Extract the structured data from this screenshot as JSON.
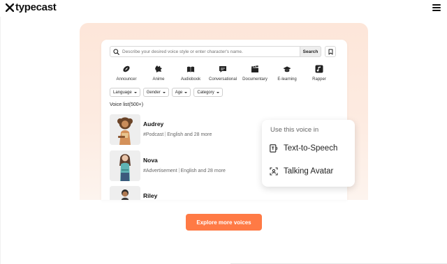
{
  "header": {
    "logo_text": "typecast",
    "menu_icon": "hamburger-menu-icon"
  },
  "search": {
    "placeholder": "Describe your desired voice style or enter character's name.",
    "button_label": "Search",
    "bookmark_icon": "bookmark-icon"
  },
  "categories": [
    {
      "label": "Announcer",
      "icon": "football-icon"
    },
    {
      "label": "Anime",
      "icon": "anime-icon"
    },
    {
      "label": "Audiobook",
      "icon": "book-icon"
    },
    {
      "label": "Conversational",
      "icon": "chat-bubble-icon"
    },
    {
      "label": "Documentary",
      "icon": "clapperboard-icon"
    },
    {
      "label": "E-learning",
      "icon": "graduation-cap-icon"
    },
    {
      "label": "Rapper",
      "icon": "music-note-icon"
    }
  ],
  "filters": [
    {
      "label": "Language"
    },
    {
      "label": "Gender"
    },
    {
      "label": "Age"
    },
    {
      "label": "Category"
    }
  ],
  "voice_list": {
    "title": "Voice list(500+)",
    "items": [
      {
        "name": "Audrey",
        "tag": "#Podcast",
        "languages": "English and 28 more"
      },
      {
        "name": "Nova",
        "tag": "#Advertisement",
        "languages": "English and 28 more"
      },
      {
        "name": "Riley",
        "tag": "",
        "languages": ""
      }
    ]
  },
  "popup": {
    "title": "Use this voice in",
    "options": [
      {
        "label": "Text-to-Speech",
        "icon": "text-to-speech-icon"
      },
      {
        "label": "Talking Avatar",
        "icon": "talking-avatar-icon"
      }
    ]
  },
  "cta": {
    "label": "Explore more voices"
  },
  "colors": {
    "accent": "#ff7a45",
    "hero_bg": "#fde6d9"
  }
}
